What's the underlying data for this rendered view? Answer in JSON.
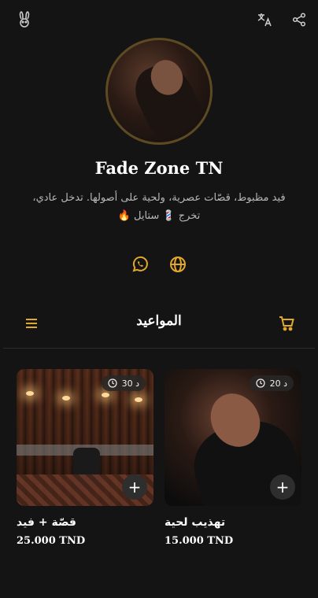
{
  "header": {
    "logo_icon": "bunny-logo-icon",
    "translate_icon": "translate-icon",
    "share_icon": "share-icon"
  },
  "profile": {
    "name": "Fade Zone TN",
    "description": "فيد مظبوط، قصّات عصرية، ولحية على أصولها. تدخل عادي، تخرج 💈 ستايل 🔥"
  },
  "contacts": {
    "whatsapp_icon": "whatsapp-icon",
    "website_icon": "globe-icon",
    "accent": "#e2a82a"
  },
  "section": {
    "title": "المواعيد",
    "menu_icon": "menu-icon",
    "cart_icon": "cart-icon"
  },
  "services": [
    {
      "title": "قصّة + فيد",
      "price": "25.000 TND",
      "duration": "30 د",
      "add_label": "+"
    },
    {
      "title": "تهذيب لحية",
      "price": "15.000 TND",
      "duration": "20 د",
      "add_label": "+"
    }
  ],
  "colors": {
    "background": "#141414",
    "accent": "#e2a82a",
    "avatar_ring": "#5e4a22"
  }
}
